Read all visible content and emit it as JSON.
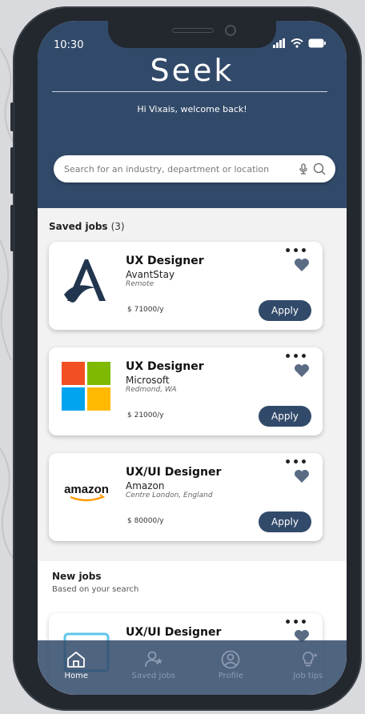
{
  "status_bar": {
    "time": "10:30"
  },
  "header": {
    "logo": "Seek",
    "welcome": "Hi Vixais, welcome back!"
  },
  "search": {
    "placeholder": "Search for an industry, department or location"
  },
  "saved_jobs": {
    "title": "Saved jobs",
    "count": "(3)",
    "items": [
      {
        "title": "UX Designer",
        "company": "AvantStay",
        "location": "Remote",
        "salary": "$ 71000/y",
        "apply": "Apply",
        "more": "•••"
      },
      {
        "title": "UX Designer",
        "company": "Microsoft",
        "location": "Redmond, WA",
        "salary": "$ 21000/y",
        "apply": "Apply",
        "more": "•••"
      },
      {
        "title": "UX/UI Designer",
        "company": "Amazon",
        "location": "Centre London, England",
        "salary": "$ 80000/y",
        "apply": "Apply",
        "more": "•••",
        "logo_text": "amazon"
      }
    ]
  },
  "new_jobs": {
    "title": "New jobs",
    "subtitle": "Based on your search",
    "items": [
      {
        "title": "UX/UI Designer",
        "more": "•••"
      }
    ]
  },
  "bottom_nav": [
    {
      "label": "Home",
      "icon": "home-icon",
      "active": true
    },
    {
      "label": "Saved jobs",
      "icon": "saved-jobs-icon",
      "active": false
    },
    {
      "label": "Profile",
      "icon": "profile-icon",
      "active": false
    },
    {
      "label": "Job tips",
      "icon": "lightbulb-icon",
      "active": false
    }
  ],
  "colors": {
    "primary": "#324a6a",
    "background": "#f2f2f3",
    "heart": "#5a6c84",
    "nav_active": "#ffffff",
    "nav_inactive": "#8c9ab0"
  }
}
